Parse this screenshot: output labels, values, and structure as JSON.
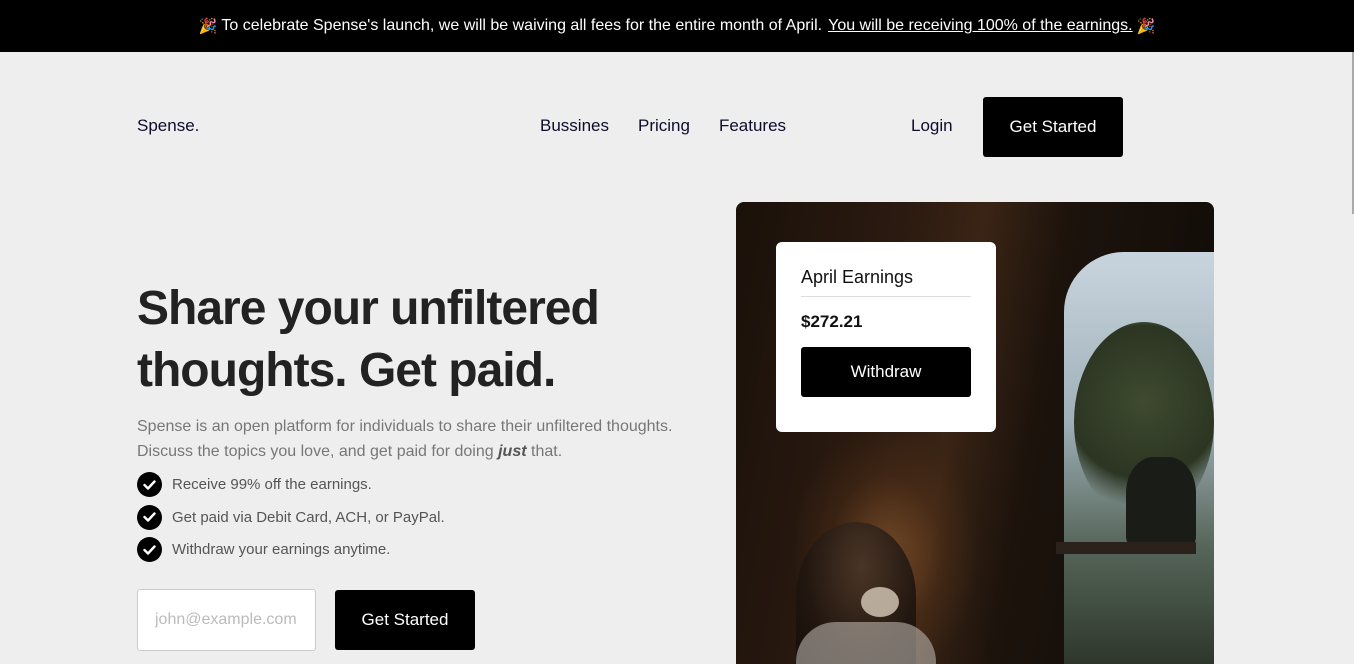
{
  "banner": {
    "emoji_left": "🎉",
    "text": "To celebrate Spense's launch, we will  be waiving all fees for the entire month of April.",
    "link_text": "You will be receiving 100% of the earnings.",
    "emoji_right": "🎉"
  },
  "header": {
    "logo": "Spense.",
    "nav": [
      "Bussines",
      "Pricing",
      "Features"
    ],
    "login": "Login",
    "cta": "Get Started"
  },
  "hero": {
    "headline_line1": "Share your unfiltered",
    "headline_line2": "thoughts. Get paid.",
    "sub_line1": "Spense is an open platform for individuals to share their unfiltered thoughts.",
    "sub_line2_pre": "Discuss the topics you love, and get paid for doing",
    "sub_line2_em": "just",
    "sub_line2_post": "that.",
    "checklist": [
      "Receive 99% off the earnings.",
      "Get paid via Debit Card, ACH, or PayPal.",
      "Withdraw your earnings anytime."
    ],
    "email_placeholder": "john@example.com",
    "cta": "Get Started"
  },
  "earnings_card": {
    "title": "April Earnings",
    "amount": "$272.21",
    "button": "Withdraw"
  },
  "colors": {
    "banner_bg": "#000000",
    "page_bg": "#eeeeee",
    "button_bg": "#000000",
    "button_text": "#ffffff"
  },
  "icons": {
    "check": "check-circle-icon",
    "party": "party-popper-icon"
  }
}
